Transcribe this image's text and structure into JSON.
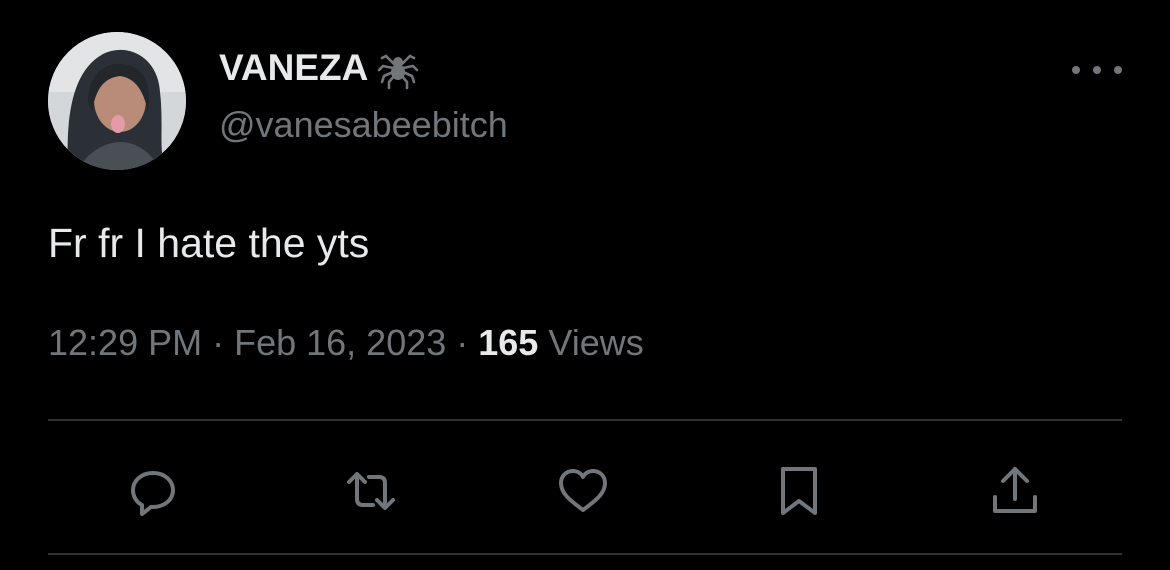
{
  "author": {
    "display_name": "VANEZA",
    "badge_icon": "spider-icon",
    "handle": "@vanesabeebitch"
  },
  "tweet": {
    "text": "Fr fr I hate the yts"
  },
  "meta": {
    "time": "12:29 PM",
    "separator1": " · ",
    "date": "Feb 16, 2023",
    "separator2": " · ",
    "views_count": "165",
    "views_label": " Views"
  },
  "actions": [
    {
      "name": "reply",
      "icon": "reply-icon"
    },
    {
      "name": "retweet",
      "icon": "retweet-icon"
    },
    {
      "name": "like",
      "icon": "heart-icon"
    },
    {
      "name": "bookmark",
      "icon": "bookmark-icon"
    },
    {
      "name": "share",
      "icon": "share-icon"
    }
  ],
  "colors": {
    "background": "#000000",
    "primary_text": "#e7e9ea",
    "secondary_text": "#71767b",
    "divider": "#2f3336"
  }
}
